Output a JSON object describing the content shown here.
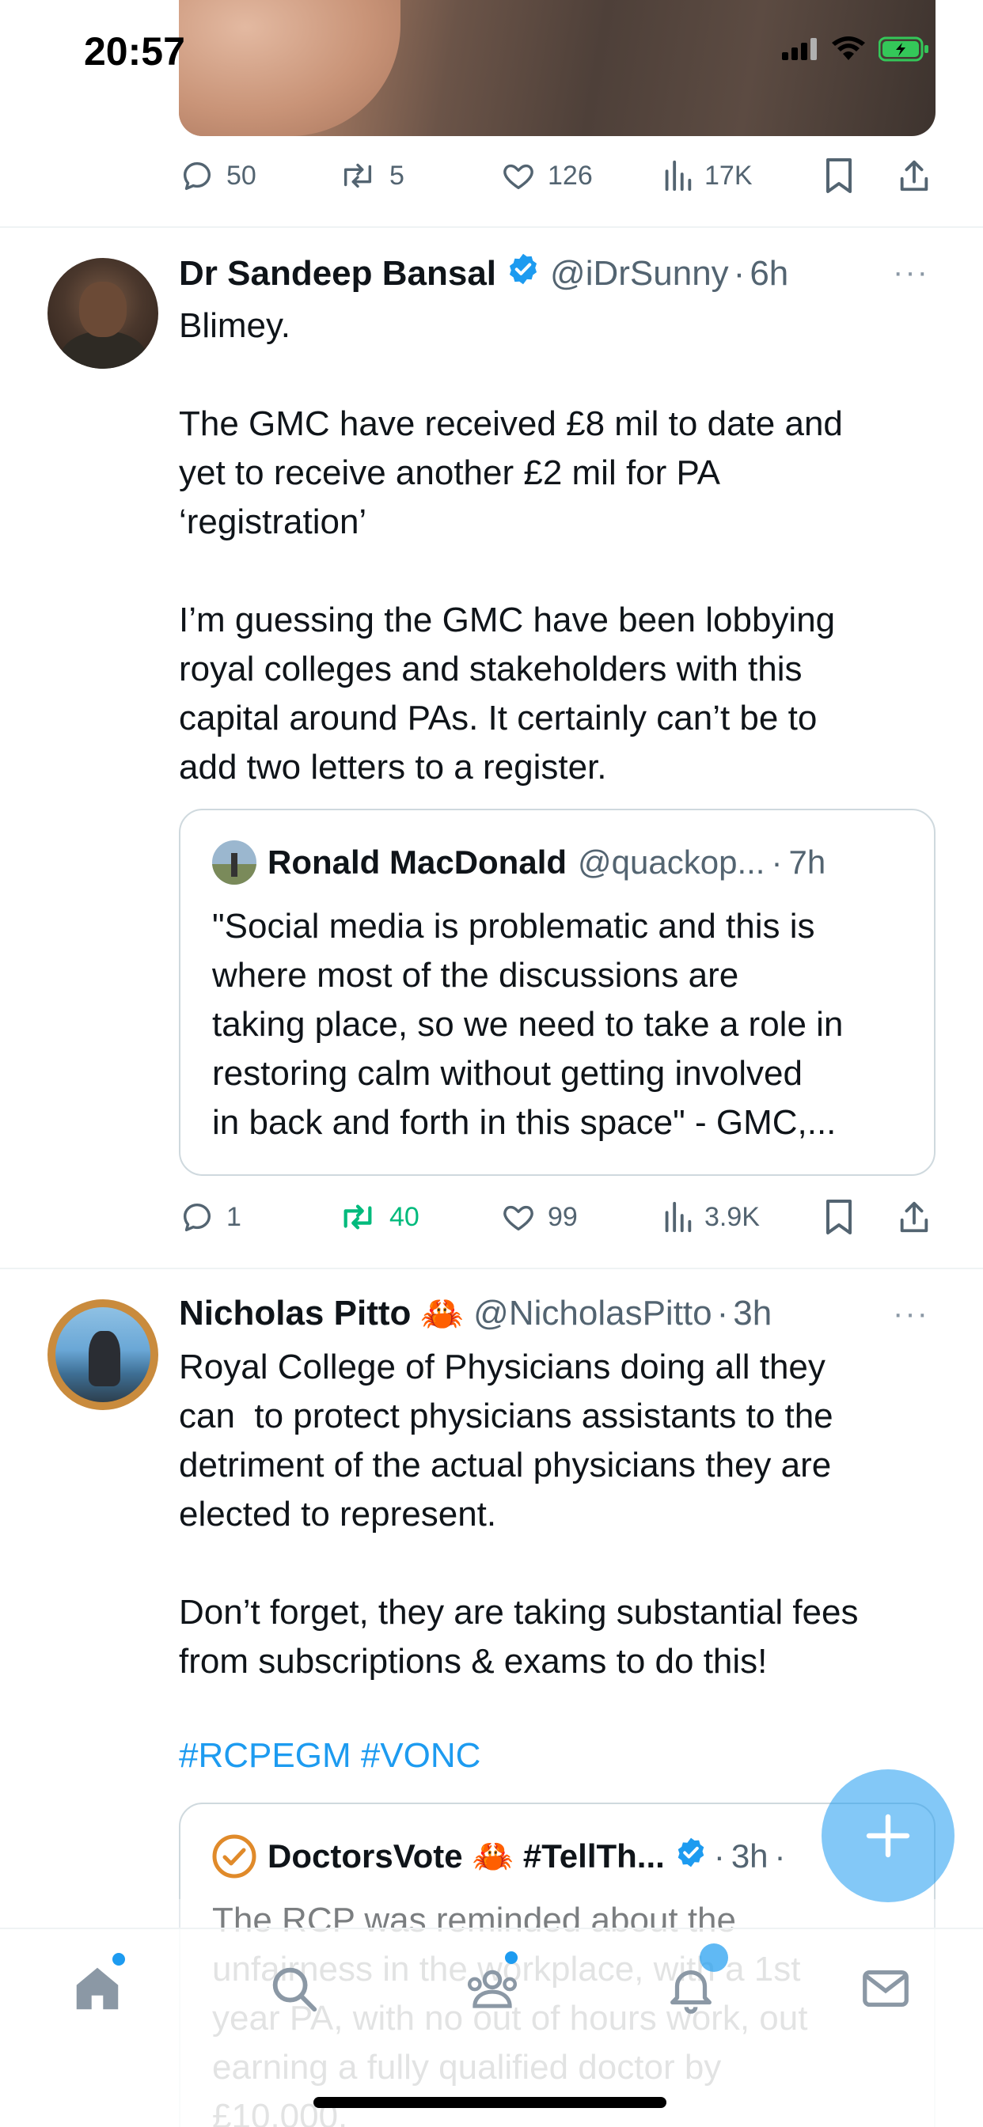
{
  "status_bar": {
    "time": "20:57"
  },
  "top_post": {
    "actions": {
      "replies": "50",
      "reposts": "5",
      "likes": "126",
      "views": "17K"
    }
  },
  "tweet1": {
    "name": "Dr Sandeep Bansal",
    "handle": "@iDrSunny",
    "separator": "·",
    "time": "6h",
    "more": "···",
    "text": "Blimey.\n\nThe GMC have received £8 mil to date and\nyet to receive another £2 mil for PA\n‘registration’\n\nI’m guessing the GMC have been lobbying\nroyal colleges and stakeholders with this\ncapital around PAs. It certainly can’t be to\nadd two letters to a register.",
    "quote": {
      "name": "Ronald MacDonald",
      "handle": "@quackop...",
      "separator": "·",
      "time": "7h",
      "text": "\"Social media is problematic and this is\nwhere most of the discussions are\ntaking place, so we need to take a role in\nrestoring calm without getting involved\nin back and forth in this space\" - GMC,..."
    },
    "actions": {
      "replies": "1",
      "reposts": "40",
      "likes": "99",
      "views": "3.9K"
    }
  },
  "tweet2": {
    "name": "Nicholas Pitto",
    "emoji": "🦀",
    "handle": "@NicholasPitto",
    "separator": "·",
    "time": "3h",
    "more": "···",
    "text": "Royal College of Physicians doing all they\ncan  to protect physicians assistants to the\ndetriment of the actual physicians they are\nelected to represent.\n\nDon’t forget, they are taking substantial fees\nfrom subscriptions & exams to do this!",
    "hashtags": "#RCPEGM #VONC",
    "quote": {
      "name": "DoctorsVote",
      "emoji": "🦀",
      "name_suffix": "#TellTh...",
      "separator": "·",
      "time": "3h",
      "separator2": "·",
      "text": "The RCP was reminded about the\nunfairness in the workplace, with a 1st\nyear PA, with no out of hours work, out\nearning a fully qualified doctor by\n£10,000."
    }
  },
  "colors": {
    "accent": "#1d9bf0",
    "text": "#0f1419",
    "muted": "#536471",
    "repost_active": "#00ba7c"
  },
  "icons": [
    "signal-icon",
    "wifi-icon",
    "battery-icon",
    "reply-icon",
    "repost-icon",
    "like-icon",
    "views-icon",
    "bookmark-icon",
    "share-icon",
    "verified-icon",
    "more-icon",
    "home-icon",
    "search-icon",
    "communities-icon",
    "notifications-icon",
    "messages-icon",
    "compose-icon"
  ]
}
